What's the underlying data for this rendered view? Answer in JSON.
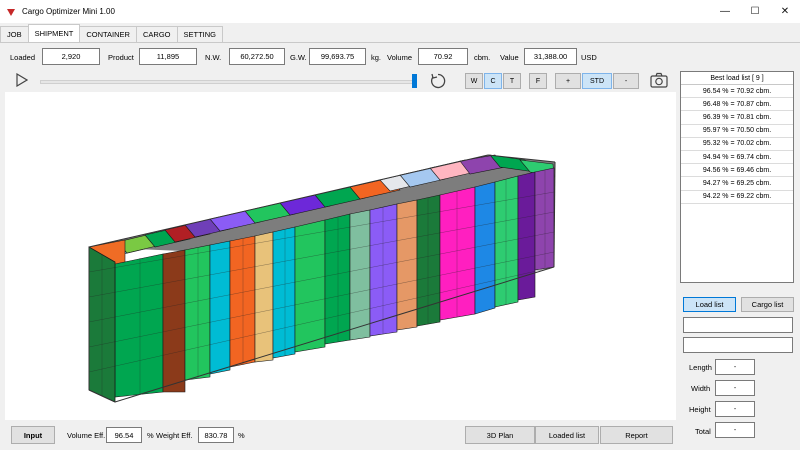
{
  "window": {
    "title": "Cargo Optimizer Mini 1.00",
    "minimize": "—",
    "maximize": "☐",
    "close": "✕"
  },
  "tabs": [
    "JOB",
    "SHIPMENT",
    "CONTAINER",
    "CARGO",
    "SETTING"
  ],
  "active_tab": "SHIPMENT",
  "info": {
    "loaded_label": "Loaded",
    "loaded": "2,920",
    "product_label": "Product",
    "product": "11,895",
    "nw_label": "N.W.",
    "nw": "60,272.50",
    "gw_label": "G.W.",
    "gw": "99,693.75",
    "weight_unit": "kg.",
    "volume_label": "Volume",
    "volume": "70.92",
    "volume_unit": "cbm.",
    "value_label": "Value",
    "value": "31,388.00",
    "currency": "USD"
  },
  "view_controls": {
    "w": "W",
    "c": "C",
    "t": "T",
    "f": "F",
    "plus": "+",
    "std": "STD",
    "minus": "-"
  },
  "best_list": {
    "header": "Best load list [ 9 ]",
    "items": [
      "96.54 % = 70.92 cbm.",
      "96.48 % = 70.87 cbm.",
      "96.39 % = 70.81 cbm.",
      "95.97 % = 70.50 cbm.",
      "95.32 % = 70.02 cbm.",
      "94.94 % = 69.74 cbm.",
      "94.56 % = 69.46 cbm.",
      "94.27 % = 69.25 cbm.",
      "94.22 % = 69.22 cbm."
    ]
  },
  "side": {
    "load_list": "Load list",
    "cargo_list": "Cargo list",
    "length_label": "Length",
    "length": "-",
    "width_label": "Width",
    "width": "-",
    "height_label": "Height",
    "height": "-",
    "total_label": "Total",
    "total": "-"
  },
  "bottom": {
    "input": "Input",
    "vol_eff_label": "Volume Eff.",
    "vol_eff": "96.54",
    "pct": "%",
    "weight_eff_label": "Weight Eff.",
    "weight_eff": "830.78",
    "pct2": "%",
    "plan_3d": "3D Plan",
    "loaded_list": "Loaded list",
    "report": "Report"
  },
  "colors": {
    "accent": "#0078d7",
    "selected": "#cce4f7"
  }
}
